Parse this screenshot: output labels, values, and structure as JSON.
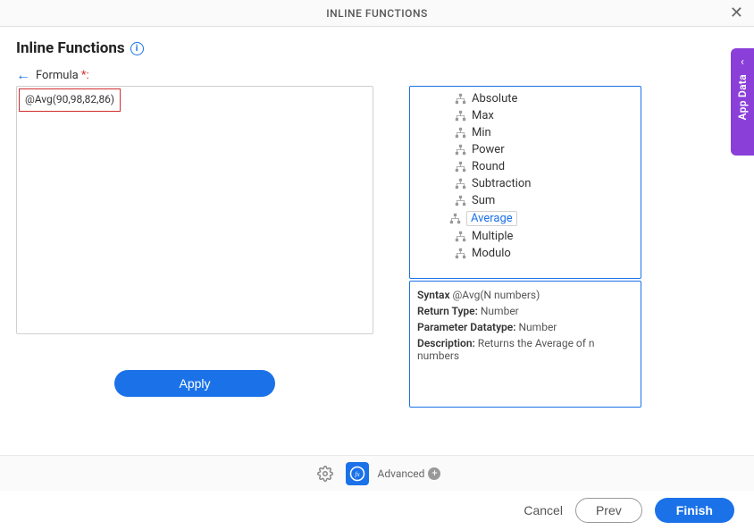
{
  "header": {
    "title": "INLINE FUNCTIONS"
  },
  "section": {
    "title": "Inline Functions"
  },
  "formula": {
    "label": "Formula ",
    "required": "*:",
    "value": "@Avg(90,98,82,86)"
  },
  "apply_label": "Apply",
  "functions": [
    {
      "name": "Absolute"
    },
    {
      "name": "Max"
    },
    {
      "name": "Min"
    },
    {
      "name": "Power"
    },
    {
      "name": "Round"
    },
    {
      "name": "Subtraction"
    },
    {
      "name": "Sum"
    },
    {
      "name": "Average",
      "selected": true
    },
    {
      "name": "Multiple"
    },
    {
      "name": "Modulo"
    }
  ],
  "detail": {
    "syntax_label": "Syntax",
    "syntax_value": "@Avg(N numbers)",
    "return_label": "Return Type:",
    "return_value": "Number",
    "param_label": "Parameter Datatype:",
    "param_value": "Number",
    "desc_label": "Description:",
    "desc_value": "Returns the Average of n numbers"
  },
  "footer": {
    "advanced_label": "Advanced"
  },
  "actions": {
    "cancel": "Cancel",
    "prev": "Prev",
    "finish": "Finish"
  },
  "side_tab": {
    "label": "App Data"
  }
}
